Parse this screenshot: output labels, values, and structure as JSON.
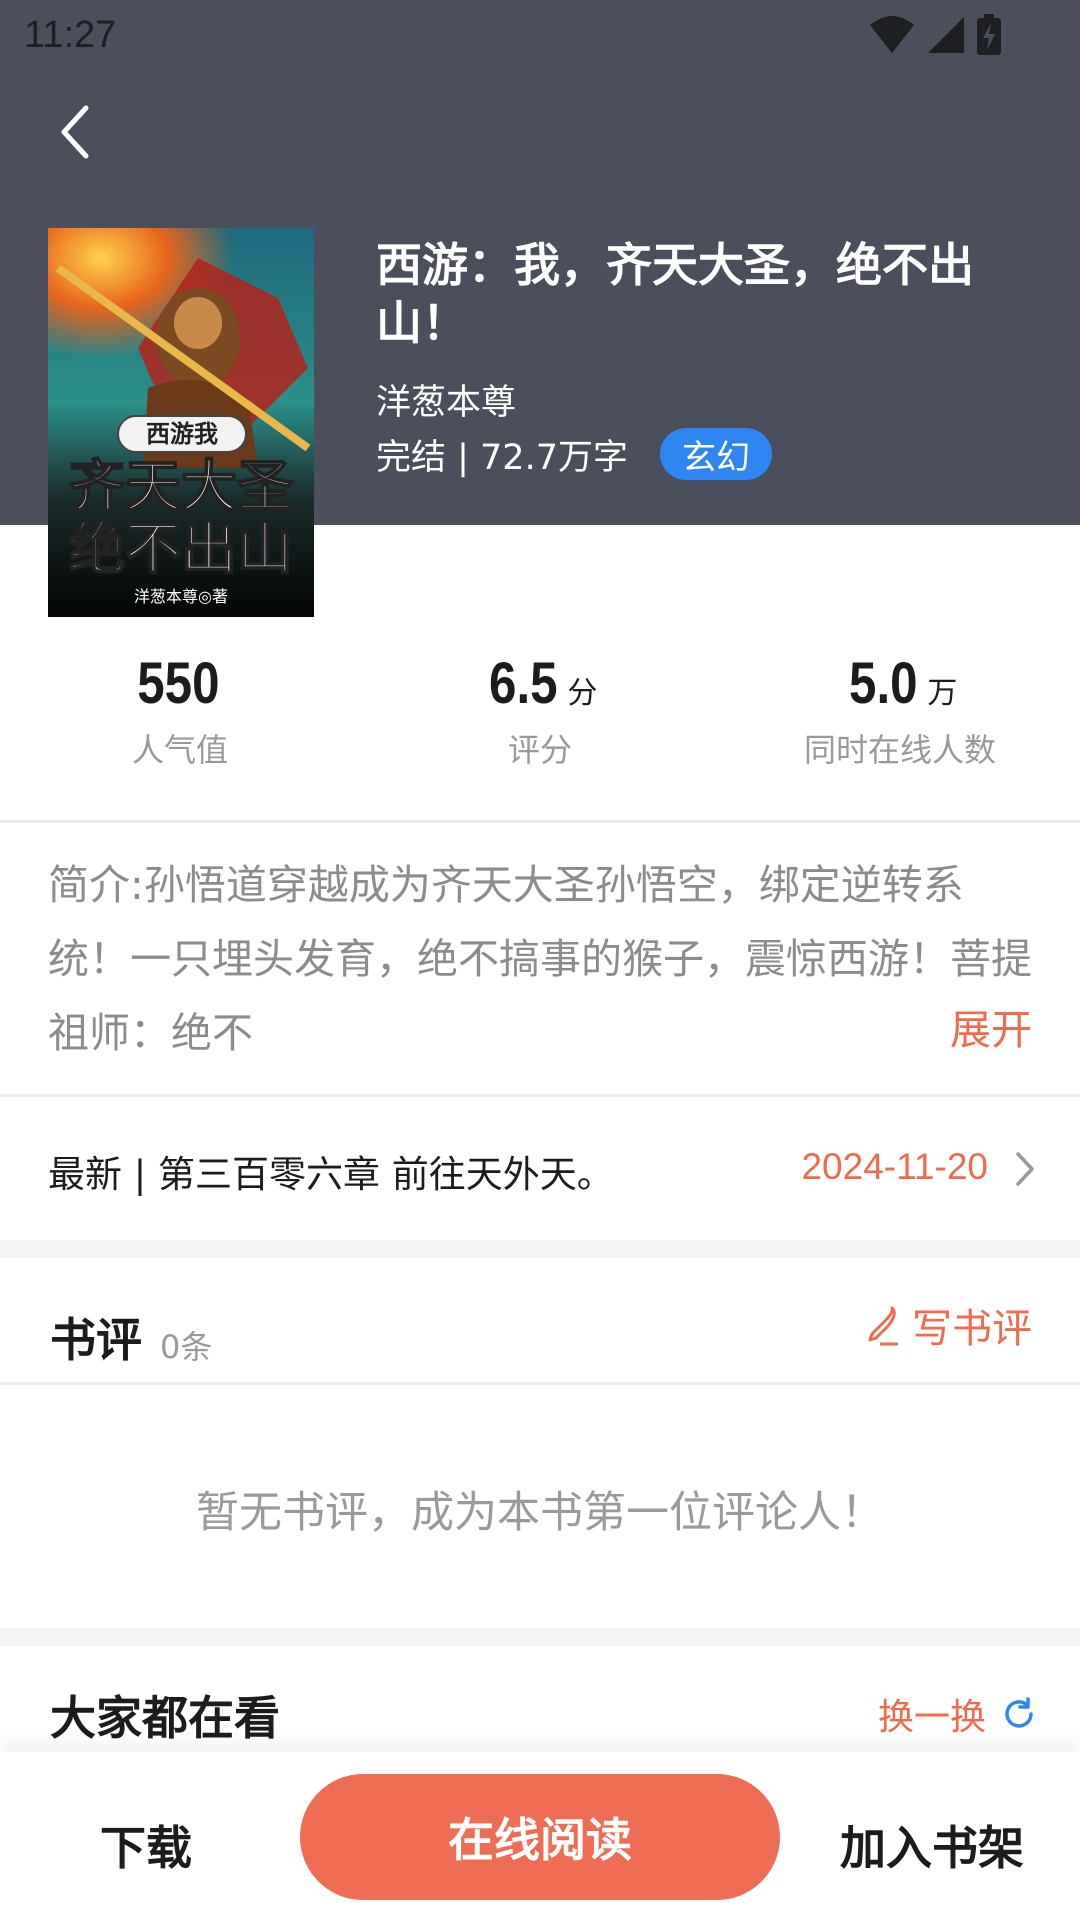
{
  "status_bar": {
    "time": "11:27"
  },
  "book": {
    "title": "西游：我，齐天大圣，绝不出山！",
    "author": "洋葱本尊",
    "status_words": "完结 | 72.7万字",
    "genre": "玄幻",
    "cover": {
      "text_top": "西游我",
      "text_line1": "齐天大圣",
      "text_line2": "绝不出山",
      "text_author": "洋葱本尊◎著"
    }
  },
  "stats": [
    {
      "value": "550",
      "unit": "",
      "label": "人气值"
    },
    {
      "value": "6.5",
      "unit": "分",
      "label": "评分"
    },
    {
      "value": "5.0",
      "unit": "万",
      "label": "同时在线人数"
    }
  ],
  "intro": {
    "text": "简介:孙悟道穿越成为齐天大圣孙悟空，绑定逆转系统！一只埋头发育，绝不搞事的猴子，震惊西游！菩提祖师：绝不",
    "expand_label": "展开"
  },
  "latest": {
    "text": "最新 | 第三百零六章 前往天外天。",
    "date": "2024-11-20"
  },
  "reviews": {
    "title": "书评",
    "count": "0条",
    "write_label": "写书评",
    "empty_text": "暂无书评，成为本书第一位评论人！"
  },
  "popular": {
    "title": "大家都在看",
    "refresh_label": "换一换"
  },
  "bottom_bar": {
    "download_label": "下载",
    "read_label": "在线阅读",
    "shelf_label": "加入书架"
  },
  "colors": {
    "header_bg": "#4a4f5b",
    "accent": "#ef6d54",
    "genre_badge": "#2f86f2",
    "refresh_icon": "#2f86f2"
  }
}
